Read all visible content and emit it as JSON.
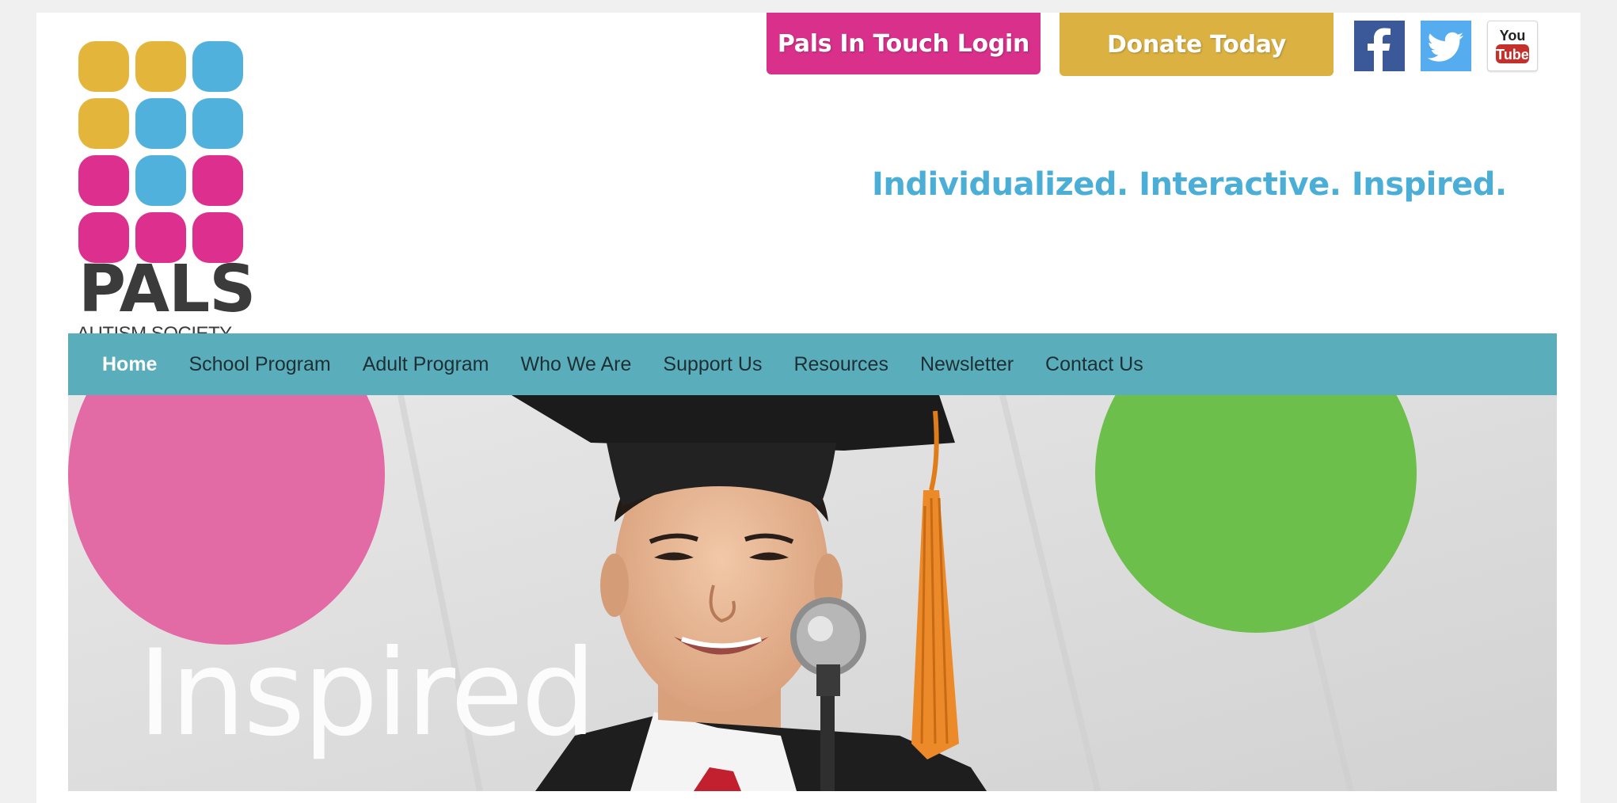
{
  "logo": {
    "name": "PALS",
    "subtitle": "AUTISM SOCIETY",
    "colors": {
      "yellow": "#e3b53a",
      "blue": "#4fb1dc",
      "pink": "#dd2f8d"
    }
  },
  "header": {
    "login_button": "Pals In Touch Login",
    "donate_button": "Donate Today",
    "tagline": "Individualized. Interactive. Inspired.",
    "social": [
      {
        "name": "facebook",
        "icon": "facebook-icon"
      },
      {
        "name": "twitter",
        "icon": "twitter-icon"
      },
      {
        "name": "youtube",
        "icon": "youtube-icon",
        "label_top": "You",
        "label_bottom": "Tube"
      }
    ]
  },
  "nav": {
    "items": [
      {
        "label": "Home",
        "active": true
      },
      {
        "label": "School Program"
      },
      {
        "label": "Adult Program"
      },
      {
        "label": "Who We Are"
      },
      {
        "label": "Support Us"
      },
      {
        "label": "Resources"
      },
      {
        "label": "Newsletter"
      },
      {
        "label": "Contact Us"
      }
    ]
  },
  "hero": {
    "caption": "Inspired",
    "image": "graduate speaking at microphone"
  },
  "colors": {
    "nav_bg": "#5aaebc",
    "login_bg": "#d9318b",
    "donate_bg": "#dbb142",
    "tagline": "#4aaed7"
  }
}
